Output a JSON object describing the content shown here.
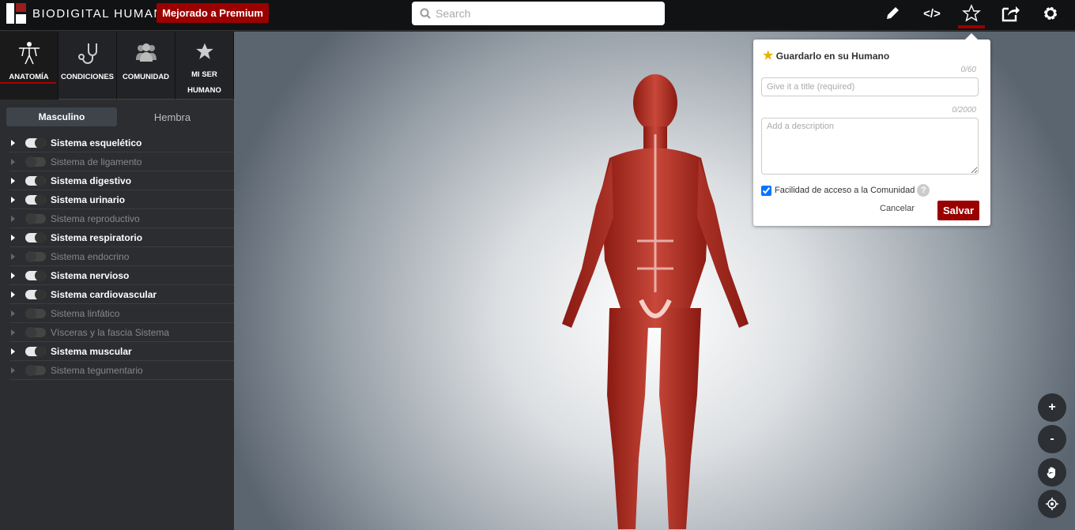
{
  "header": {
    "brand": "BIODIGITAL HUMAN",
    "premium_label": "Mejorado a Premium",
    "search_placeholder": "Search",
    "accent": "#9b0000"
  },
  "sidebar": {
    "tabs": [
      {
        "label": "ANATOMÍA",
        "icon": "body-icon"
      },
      {
        "label": "CONDICIONES",
        "icon": "stethoscope-icon"
      },
      {
        "label": "COMUNIDAD",
        "icon": "people-icon"
      },
      {
        "label": "MI SER HUMANO",
        "icon": "star-icon"
      }
    ],
    "gender": [
      "Masculino",
      "Hembra"
    ],
    "systems": [
      {
        "label": "Sistema esquelético",
        "on": true
      },
      {
        "label": "Sistema de ligamento",
        "on": false
      },
      {
        "label": "Sistema digestivo",
        "on": true
      },
      {
        "label": "Sistema urinario",
        "on": true
      },
      {
        "label": "Sistema reproductivo",
        "on": false
      },
      {
        "label": "Sistema respiratorio",
        "on": true
      },
      {
        "label": "Sistema endocrino",
        "on": false
      },
      {
        "label": "Sistema nervioso",
        "on": true
      },
      {
        "label": "Sistema cardiovascular",
        "on": true
      },
      {
        "label": "Sistema linfático",
        "on": false
      },
      {
        "label": "Vísceras y la fascia Sistema",
        "on": false
      },
      {
        "label": "Sistema muscular",
        "on": true
      },
      {
        "label": "Sistema tegumentario",
        "on": false
      }
    ]
  },
  "save_popup": {
    "title": "Guardarlo en su Humano",
    "title_count": "0/60",
    "title_placeholder": "Give it a title (required)",
    "desc_count": "0/2000",
    "desc_placeholder": "Add a description",
    "community_label": "Facilidad de acceso a la Comunidad",
    "community_checked": true,
    "help": "?",
    "cancel": "Cancelar",
    "save": "Salvar"
  },
  "controls": {
    "zoom_in": "+",
    "zoom_out": "-"
  }
}
